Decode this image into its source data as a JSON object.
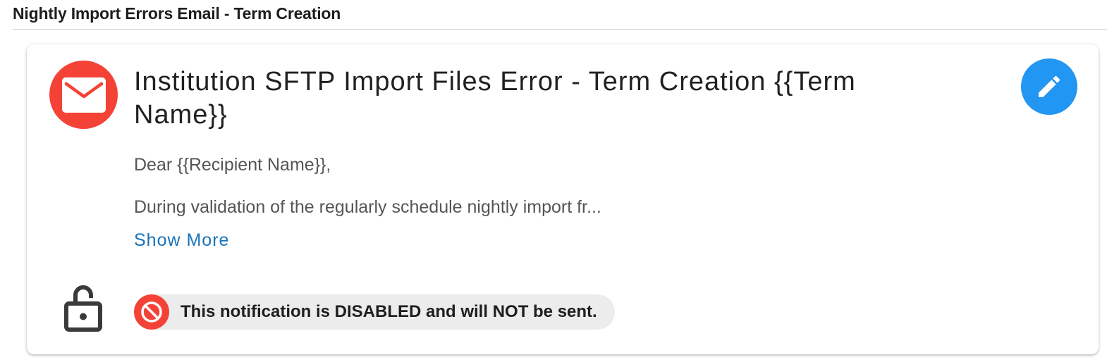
{
  "section": {
    "title": "Nightly Import Errors Email - Term Creation"
  },
  "card": {
    "icon": "mail-icon",
    "title": "Institution SFTP Import Files Error - Term Creation {{Term Name}}",
    "greeting": "Dear {{Recipient Name}},",
    "preview": "During validation of the regularly schedule nightly import fr...",
    "show_more_label": "Show More",
    "edit_icon": "pencil-icon",
    "lock_icon": "lock-open-icon",
    "status": {
      "icon": "block-icon",
      "text": "This notification is DISABLED and will NOT be sent."
    }
  },
  "colors": {
    "mail_avatar": "#f44336",
    "edit_button": "#2196f3",
    "link": "#1a73b8",
    "status_pill_bg": "#ececec",
    "block_icon": "#f44336"
  }
}
